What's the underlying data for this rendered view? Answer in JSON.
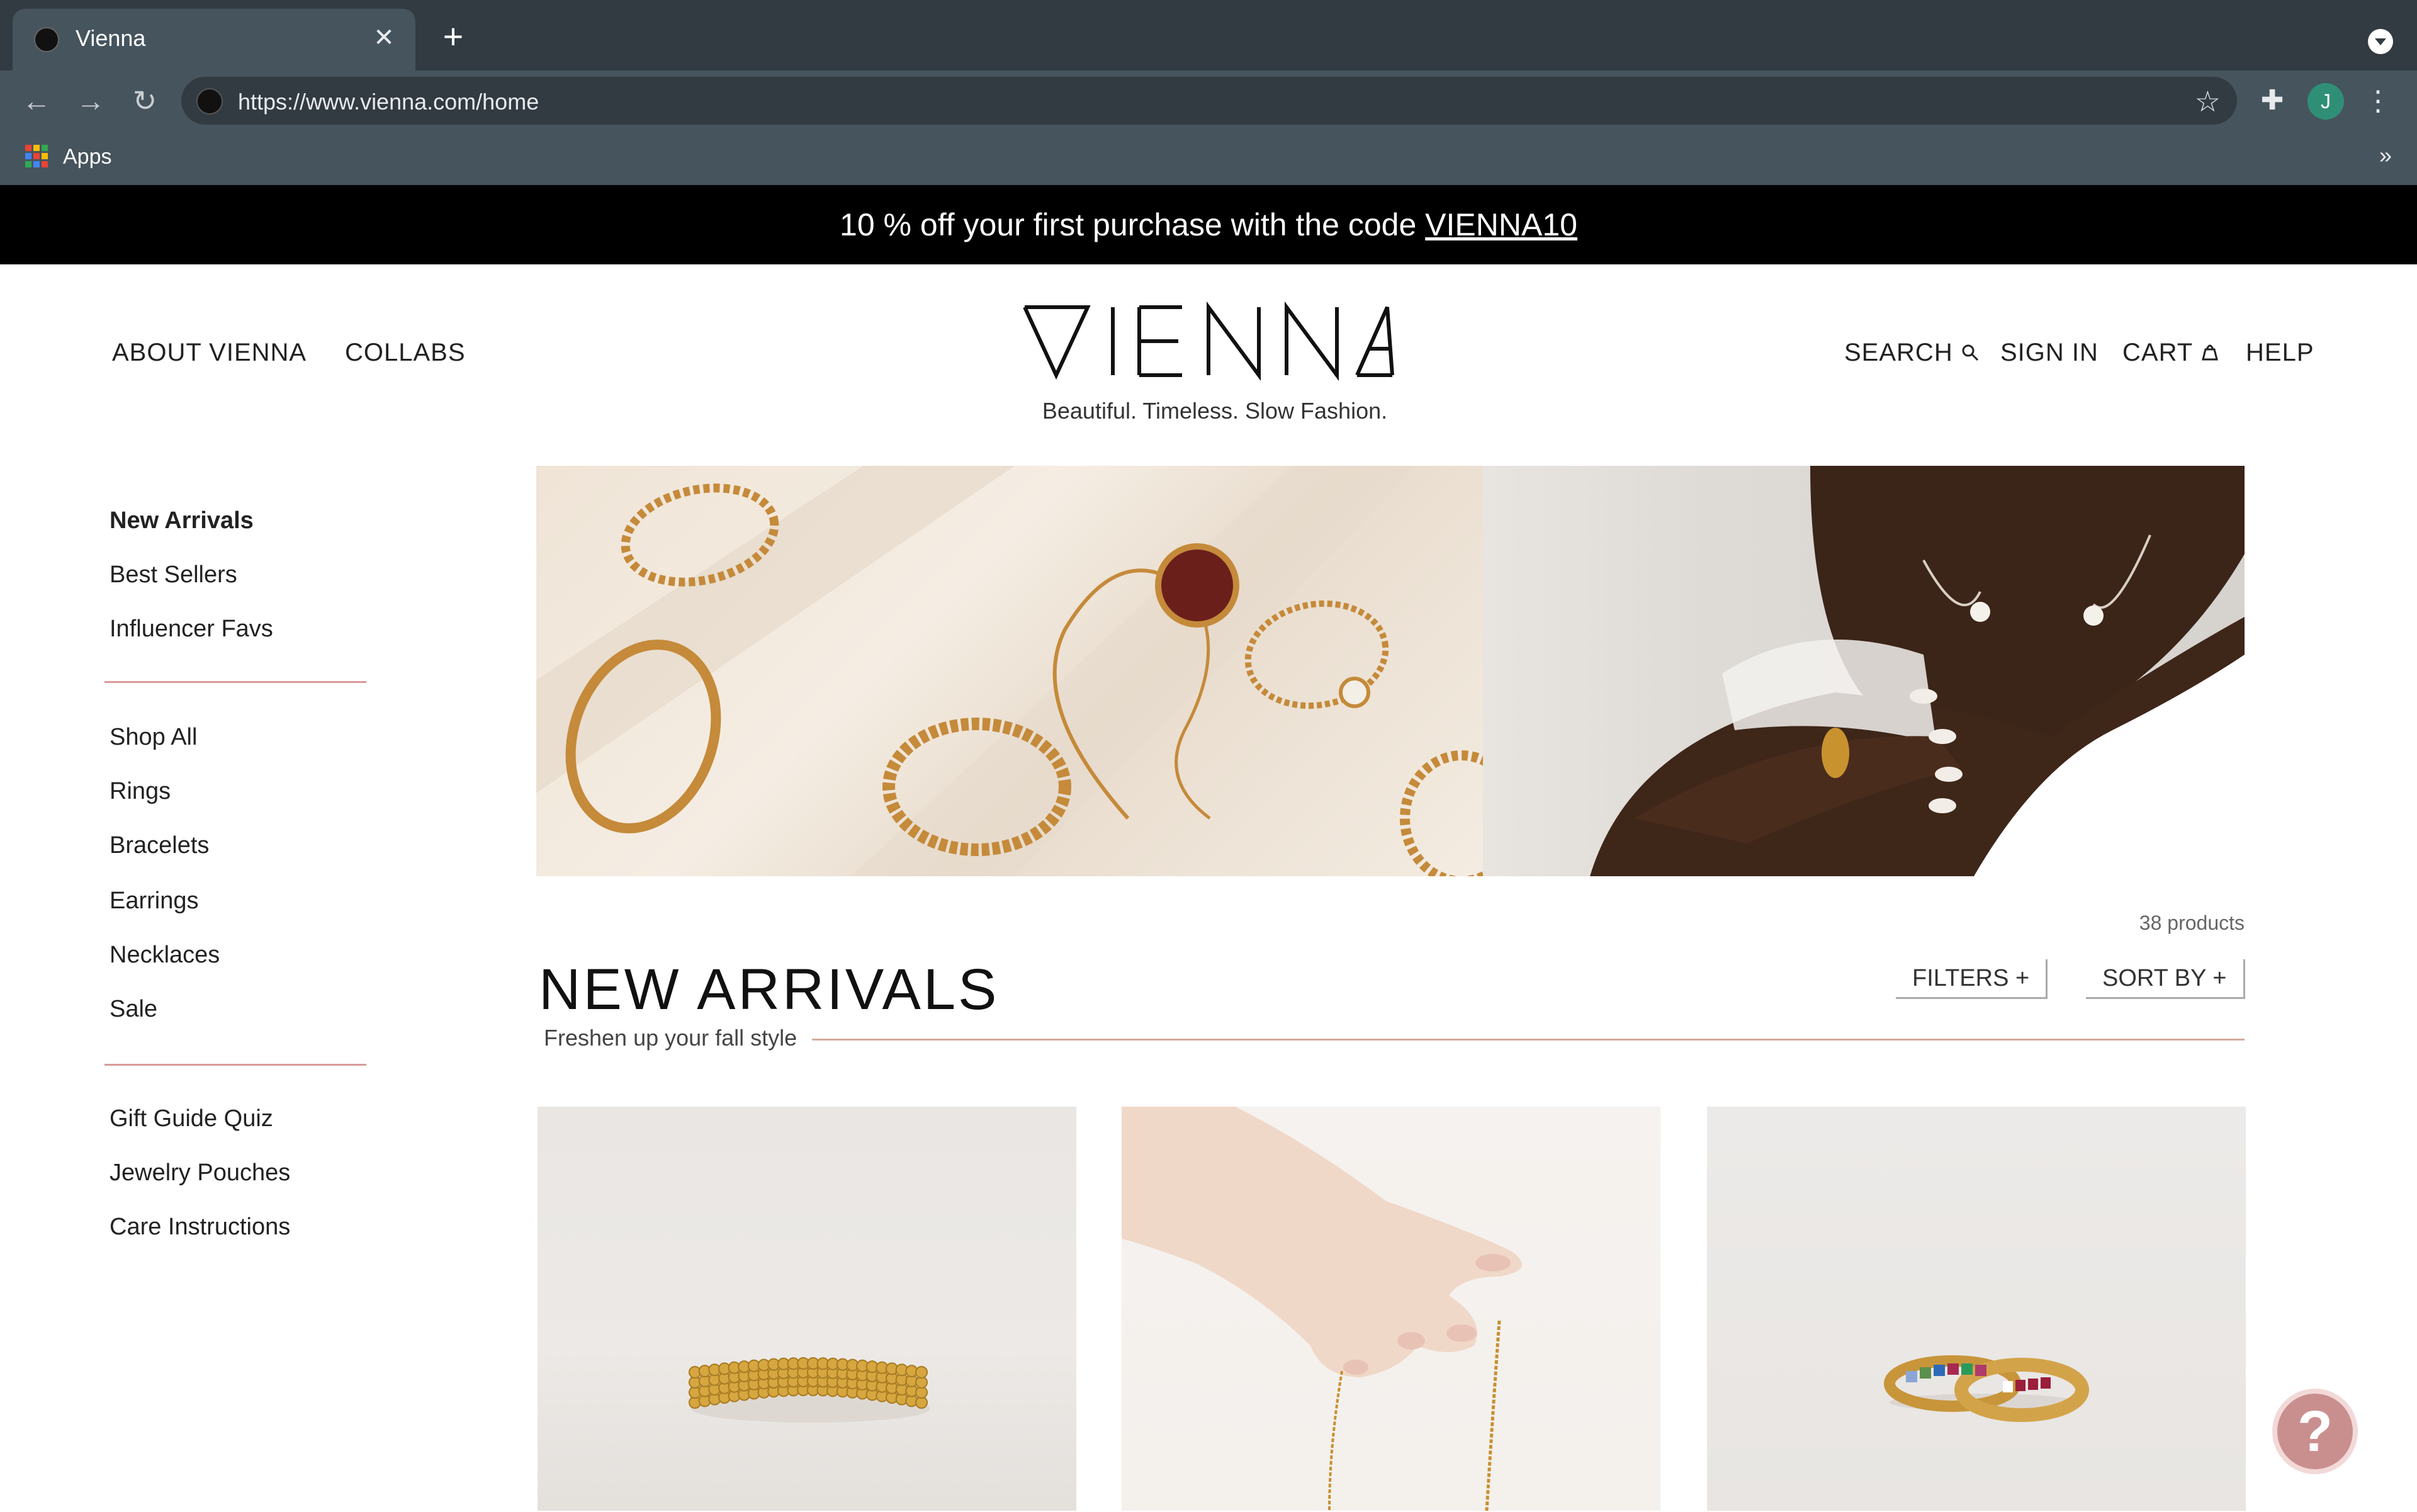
{
  "browser": {
    "tab_title": "Vienna",
    "tab_close": "✕",
    "new_tab": "+",
    "back": "←",
    "forward": "→",
    "reload": "↻",
    "url": "https://www.vienna.com/home",
    "star": "☆",
    "extensions": "✚",
    "profile_initial": "J",
    "menu": "⋮",
    "bookmarks_apps": "Apps",
    "bookmarks_more": "»",
    "apps_colors": [
      "#ea4335",
      "#fbbc05",
      "#34a853",
      "#4285f4",
      "#ea4335",
      "#fbbc05",
      "#34a853",
      "#4285f4",
      "#ea4335"
    ]
  },
  "promo": {
    "text": "10 % off your first purchase with the code ",
    "code": "VIENNA10"
  },
  "header": {
    "nav_left": [
      "ABOUT VIENNA",
      "COLLABS"
    ],
    "logo": "VIENNA",
    "tagline": "Beautiful. Timeless. Slow Fashion.",
    "search": "SEARCH",
    "sign_in": "SIGN IN",
    "cart": "CART",
    "help": "HELP"
  },
  "sidebar": {
    "group1": [
      "New Arrivals",
      "Best Sellers",
      "Influencer Favs"
    ],
    "group2": [
      "Shop All",
      "Rings",
      "Bracelets",
      "Earrings",
      "Necklaces",
      "Sale"
    ],
    "group3": [
      "Gift Guide Quiz",
      "Jewelry Pouches",
      "Care Instructions"
    ]
  },
  "products": {
    "count": "38 products",
    "title": "NEW ARRIVALS",
    "subtitle": "Freshen up your fall style",
    "filters": "FILTERS +",
    "sort": "SORT BY +"
  },
  "help_fab": "?"
}
